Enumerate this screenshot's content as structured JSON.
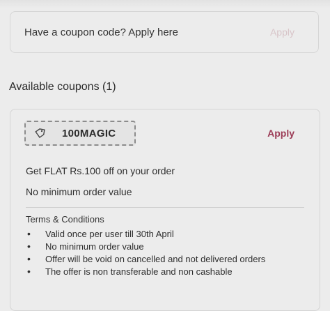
{
  "coupon_entry": {
    "placeholder": "Have a coupon code? Apply here",
    "apply_label": "Apply"
  },
  "available": {
    "title": "Available coupons (1)"
  },
  "coupon": {
    "code": "100MAGIC",
    "apply_label": "Apply",
    "description": "Get FLAT Rs.100 off on your order",
    "min_order": "No minimum order value",
    "terms_title": "Terms & Conditions",
    "terms": [
      "Valid once per user till 30th April",
      "No minimum order value",
      "Offer will be void on cancelled and not delivered orders",
      "The offer is non transferable and non cashable"
    ]
  },
  "colors": {
    "accent": "#9b3b56",
    "disabled": "#d8c5c9",
    "background": "#ececec"
  }
}
